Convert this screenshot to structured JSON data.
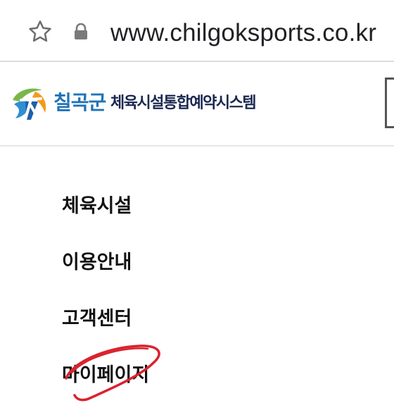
{
  "browser": {
    "url": "www.chilgoksports.co.kr",
    "bookmark_icon": "star-outline-icon",
    "security_icon": "lock-icon"
  },
  "site": {
    "logo_icon": "chilgok-logo-icon",
    "region_name": "칠곡군",
    "system_name": "체육시설통합예약시스템",
    "menu_icon": "menu-toggle-icon",
    "colors": {
      "region_blue": "#1f73b7",
      "system_navy": "#1b2850",
      "logo_green": "#7ab648",
      "logo_orange": "#f39a1e",
      "annotation_red": "#d9232e"
    }
  },
  "nav": {
    "items": [
      {
        "label": "체육시설"
      },
      {
        "label": "이용안내"
      },
      {
        "label": "고객센터"
      },
      {
        "label": "마이페이지"
      }
    ]
  }
}
